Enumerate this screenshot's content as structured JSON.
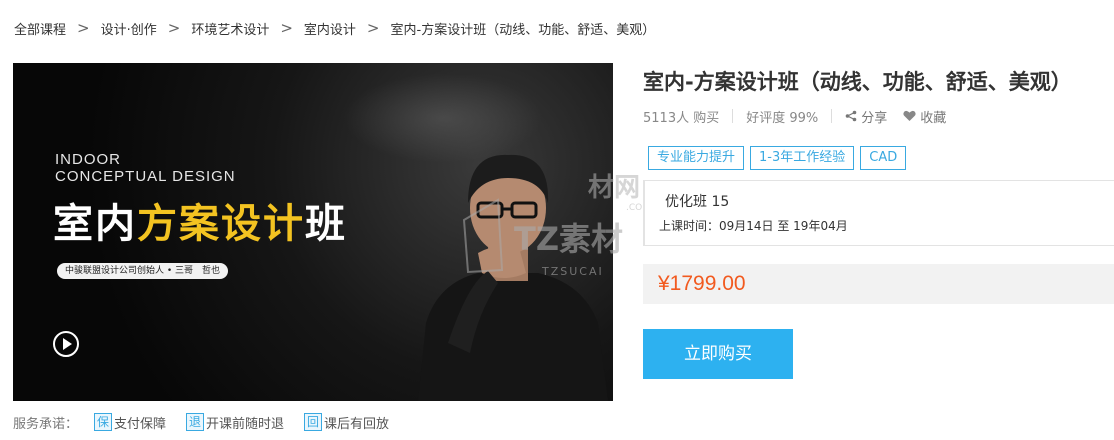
{
  "breadcrumb": {
    "items": [
      "全部课程",
      "设计·创作",
      "环境艺术设计",
      "室内设计",
      "室内-方案设计班（动线、功能、舒适、美观）"
    ],
    "separator": ">"
  },
  "banner": {
    "en_line1": "INDOOR",
    "en_line2": "CONCEPTUAL DESIGN",
    "cn_title_part1": "室内",
    "cn_title_highlight": "方案设计",
    "cn_title_part2": "班",
    "instructor": "中骏联盟设计公司创始人 • 三哥　哲也",
    "accent_color": "#f3c321"
  },
  "watermark": {
    "text_main": "TZ素材",
    "text_sub": "TZSUCAI",
    "text_top": "材网",
    "text_url": ".COM"
  },
  "course": {
    "title": "室内-方案设计班（动线、功能、舒适、美观）",
    "buyers": "5113人 购买",
    "rating": "好评度 99%",
    "share_label": "分享",
    "favorite_label": "收藏",
    "tags": [
      "专业能力提升",
      "1-3年工作经验",
      "CAD"
    ],
    "class_name": "优化班 15",
    "class_time": "上课时间：09月14日 至 19年04月",
    "price": "¥1799.00",
    "buy_label": "立即购买"
  },
  "services": {
    "label": "服务承诺：",
    "items": [
      {
        "icon_char": "保",
        "label": "支付保障",
        "icon": "payment-guarantee-icon"
      },
      {
        "icon_char": "退",
        "label": "开课前随时退",
        "icon": "refund-icon"
      },
      {
        "icon_char": "回",
        "label": "课后有回放",
        "icon": "replay-icon"
      }
    ]
  },
  "colors": {
    "brand_blue": "#2db1f0",
    "tag_blue": "#39a9e1",
    "price_orange": "#f25a1f"
  }
}
